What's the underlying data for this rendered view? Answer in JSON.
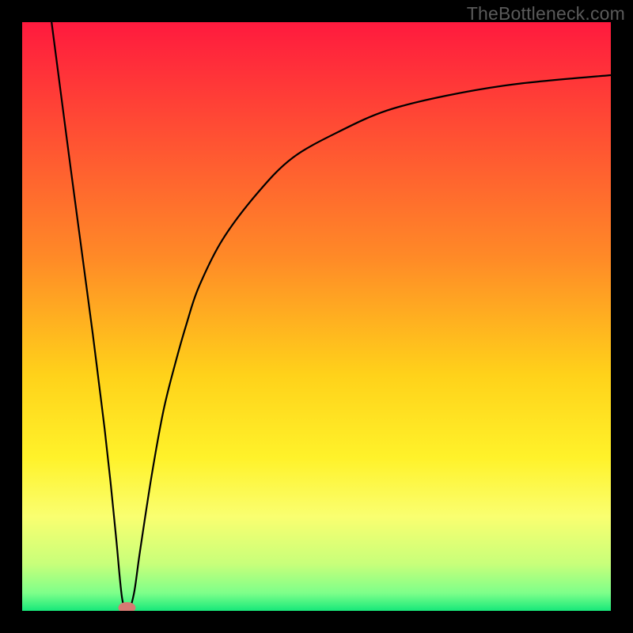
{
  "watermark": "TheBottleneck.com",
  "chart_data": {
    "type": "line",
    "title": "",
    "xlabel": "",
    "ylabel": "",
    "xlim": [
      0,
      100
    ],
    "ylim": [
      0,
      100
    ],
    "grid": false,
    "series": [
      {
        "name": "bottleneck-curve",
        "x": [
          5,
          8,
          10,
          12,
          13,
          14,
          15,
          16,
          17,
          18,
          19,
          20,
          22,
          24,
          26,
          28,
          30,
          34,
          40,
          46,
          54,
          62,
          72,
          84,
          100
        ],
        "values": [
          100,
          77,
          62,
          47,
          39,
          31,
          22,
          12,
          2,
          0,
          3,
          10,
          23,
          34,
          42,
          49,
          55,
          63,
          71,
          77,
          81.5,
          85,
          87.5,
          89.5,
          91
        ]
      }
    ],
    "marker": {
      "x": 17.8,
      "y": 0,
      "color": "#d77a73"
    },
    "background": {
      "type": "vertical-gradient",
      "stops": [
        {
          "offset": 0,
          "color": "#ff1a3e"
        },
        {
          "offset": 40,
          "color": "#ff8a27"
        },
        {
          "offset": 60,
          "color": "#ffd21a"
        },
        {
          "offset": 74,
          "color": "#fff22a"
        },
        {
          "offset": 84,
          "color": "#faff70"
        },
        {
          "offset": 92,
          "color": "#c8ff7a"
        },
        {
          "offset": 97,
          "color": "#7dff8a"
        },
        {
          "offset": 100,
          "color": "#17e87a"
        }
      ]
    }
  }
}
